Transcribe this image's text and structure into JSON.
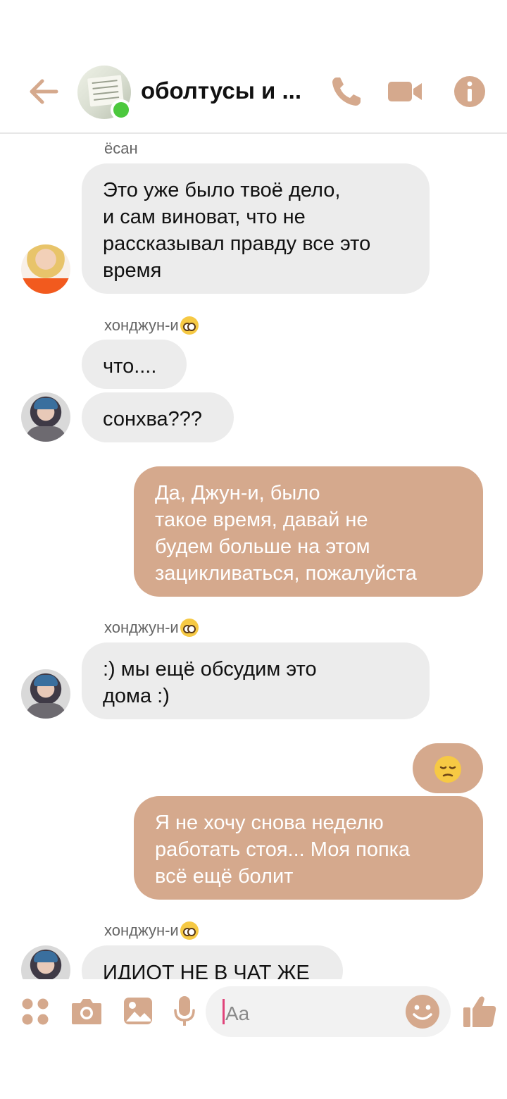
{
  "header": {
    "title": "оболтусы и ...",
    "accent_color": "#d5a98d",
    "online_color": "#4cc83d"
  },
  "messages": {
    "yesan_name": "ёсан",
    "yesan_text": "Это уже было твоё дело,\nи сам виноват, что не\nрассказывал правду все это\nвремя",
    "hj_name_1": "хонджун-и",
    "hj_text_1a": "что....",
    "hj_text_1b": "сонхва???",
    "me_text_1": "Да, Джун-и, было\nтакое время, давай не\nбудем больше на этом\nзацикливаться, пожалуйста",
    "hj_name_2": "хонджун-и",
    "hj_text_2": ":) мы ещё обсудим это\nдома :)",
    "me_emoji": "pensive-face-emoji",
    "me_text_2": "Я не хочу снова неделю\nработать стоя... Моя попка\nвсё ещё болит",
    "hj_name_3": "хонджун-и",
    "hj_text_3": "ИДИОТ НЕ В ЧАТ ЖЕ",
    "name_emoji": "pleading-face-emoji"
  },
  "composer": {
    "placeholder": "Aa"
  },
  "icons": {
    "back": "back-arrow-icon",
    "call": "phone-icon",
    "video": "video-camera-icon",
    "info": "info-icon",
    "menu": "four-dots-icon",
    "camera": "camera-icon",
    "gallery": "image-icon",
    "mic": "microphone-icon",
    "emoji": "smiley-icon",
    "like": "thumbs-up-icon"
  }
}
